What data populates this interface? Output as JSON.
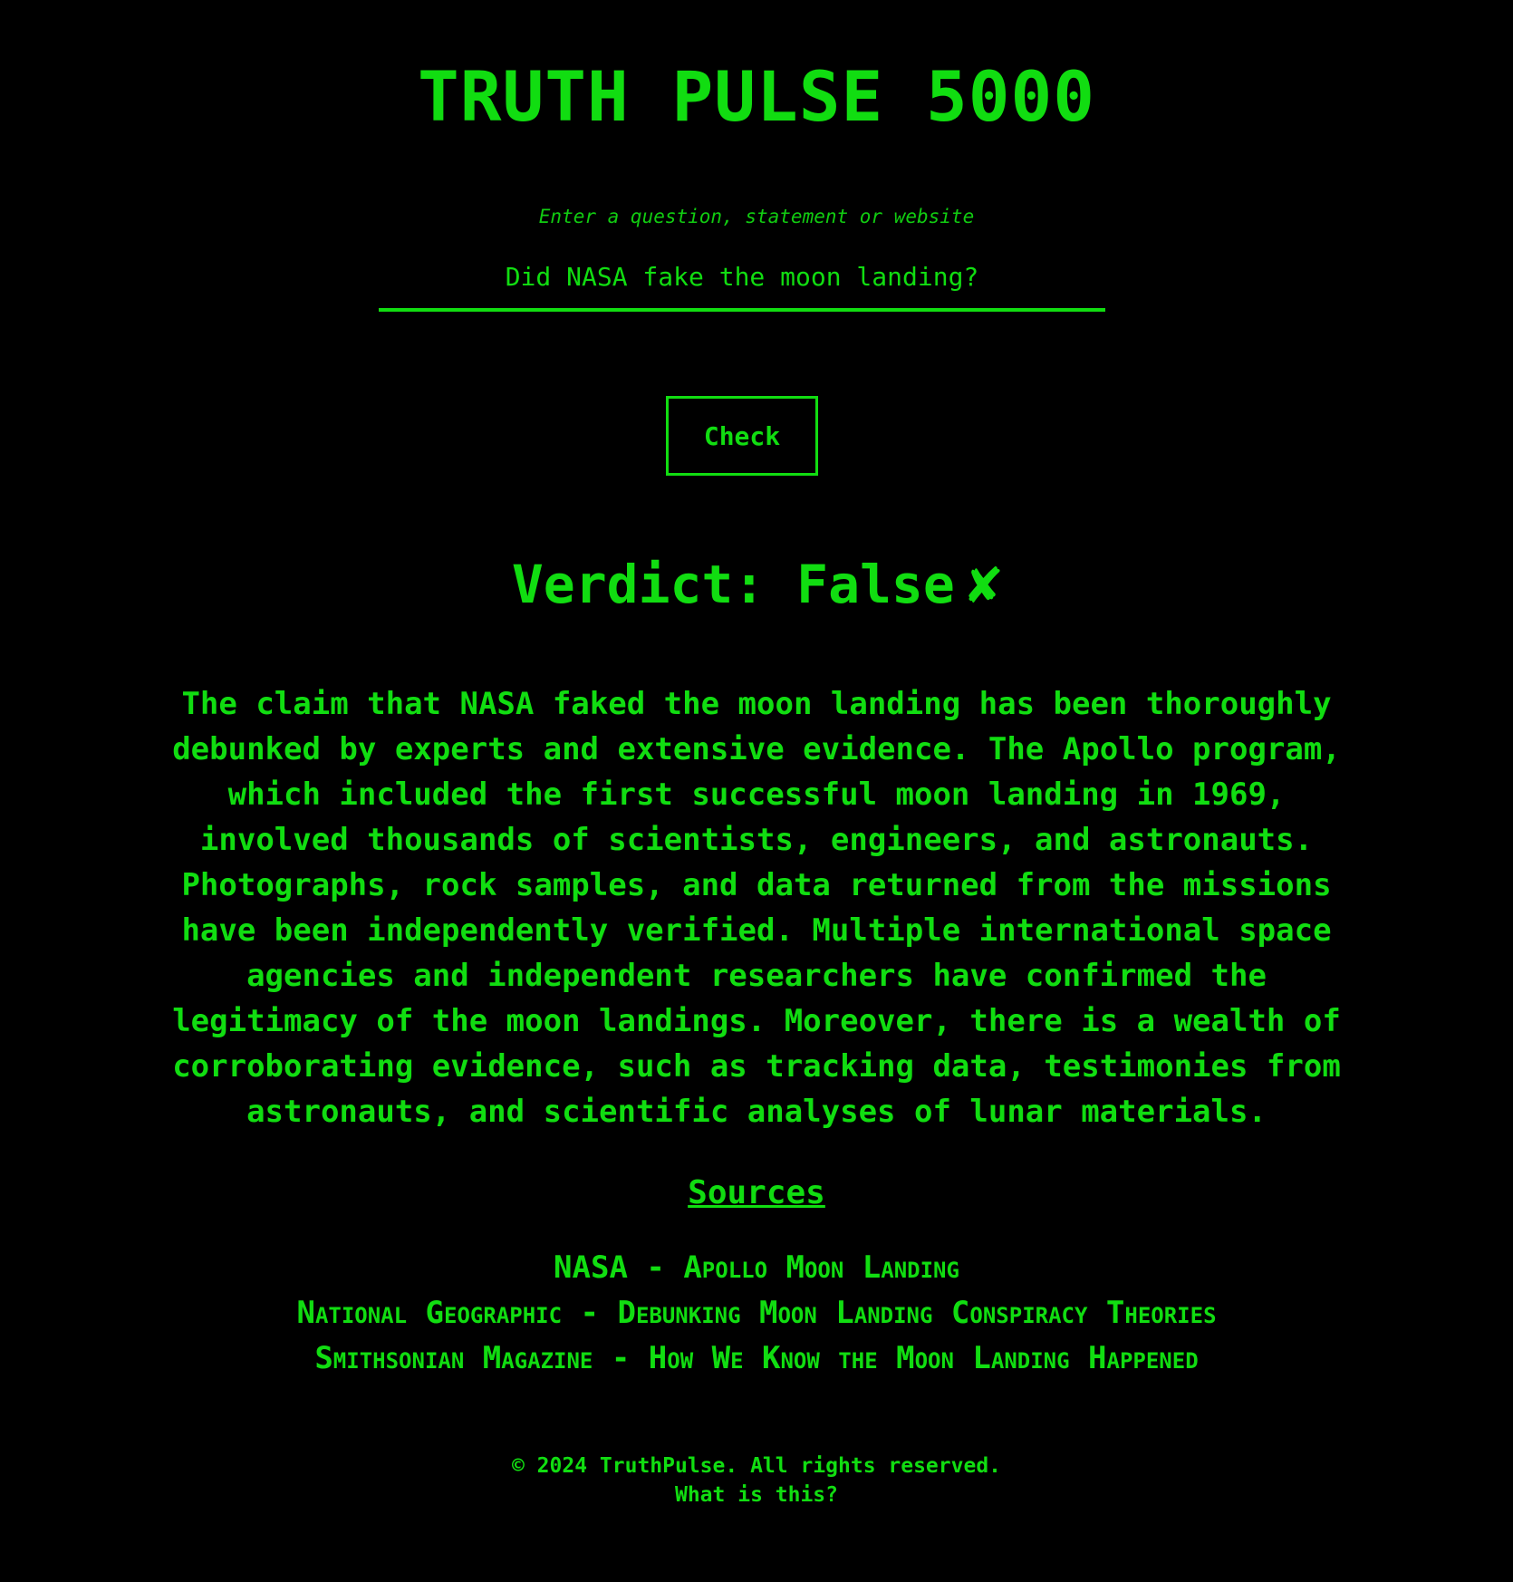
{
  "header": {
    "title": "TRUTH PULSE 5000"
  },
  "form": {
    "label": "Enter a question, statement or website",
    "query_value": "Did NASA fake the moon landing?",
    "check_label": "Check"
  },
  "result": {
    "verdict_text": "Verdict: False",
    "verdict_mark": "✘",
    "explanation": "The claim that NASA faked the moon landing has been thoroughly debunked by experts and extensive evidence. The Apollo program, which included the first successful moon landing in 1969, involved thousands of scientists, engineers, and astronauts. Photographs, rock samples, and data returned from the missions have been independently verified. Multiple international space agencies and independent researchers have confirmed the legitimacy of the moon landings. Moreover, there is a wealth of corroborating evidence, such as tracking data, testimonies from astronauts, and scientific analyses of lunar materials."
  },
  "sources": {
    "heading": "Sources",
    "items": [
      {
        "label": "NASA - Apollo Moon Landing"
      },
      {
        "label": "National Geographic - Debunking Moon Landing Conspiracy Theories"
      },
      {
        "label": "Smithsonian Magazine - How We Know the Moon Landing Happened"
      }
    ]
  },
  "footer": {
    "copyright": "© 2024 TruthPulse. All rights reserved.",
    "about_link": "What is this?"
  },
  "colors": {
    "background": "#000000",
    "accent": "#11dd11"
  }
}
